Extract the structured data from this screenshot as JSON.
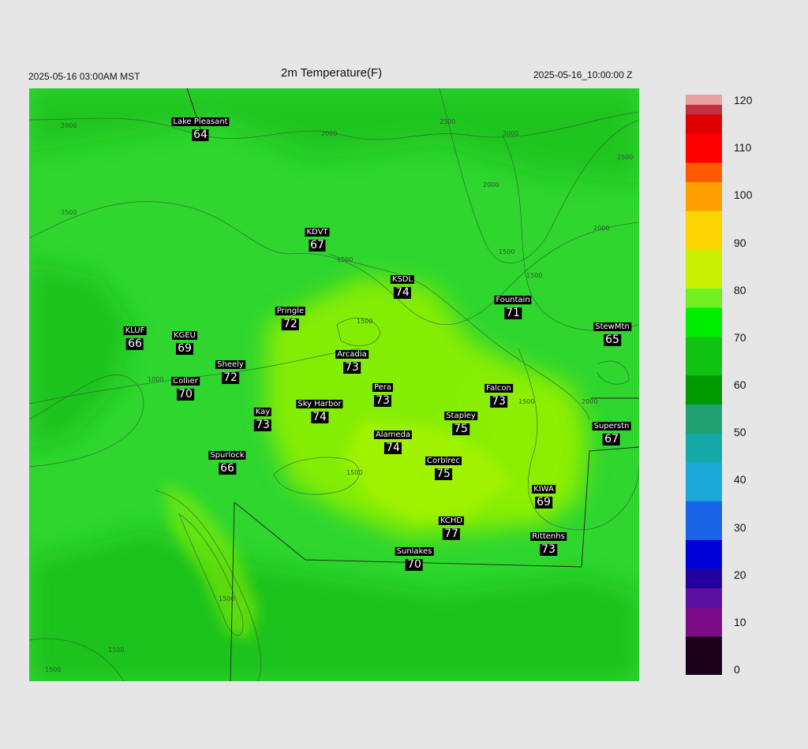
{
  "header": {
    "left": "2025-05-16 03:00AM MST",
    "title": "2m Temperature(F)",
    "right": "2025-05-16_10:00:00 Z"
  },
  "colorbar": {
    "ticks": [
      "120",
      "110",
      "100",
      "90",
      "80",
      "70",
      "60",
      "50",
      "40",
      "30",
      "20",
      "10",
      "0"
    ],
    "range": [
      0,
      120
    ],
    "stops": [
      {
        "v": 0,
        "c": "#1a0019"
      },
      {
        "v": 8,
        "c": "#7a0a86"
      },
      {
        "v": 13,
        "c": "#5b0fa0"
      },
      {
        "v": 18,
        "c": "#22009e"
      },
      {
        "v": 22,
        "c": "#0000d8"
      },
      {
        "v": 28,
        "c": "#1a64e8"
      },
      {
        "v": 35,
        "c": "#1aa8d8"
      },
      {
        "v": 43,
        "c": "#14a8a8"
      },
      {
        "v": 50,
        "c": "#20a070"
      },
      {
        "v": 55,
        "c": "#009a00"
      },
      {
        "v": 62,
        "c": "#11c311"
      },
      {
        "v": 70,
        "c": "#00ee00"
      },
      {
        "v": 76,
        "c": "#70f020"
      },
      {
        "v": 80,
        "c": "#c8f000"
      },
      {
        "v": 88,
        "c": "#ffd400"
      },
      {
        "v": 95,
        "c": "#ffa000"
      },
      {
        "v": 101,
        "c": "#ff5a00"
      },
      {
        "v": 106,
        "c": "#ff0000"
      },
      {
        "v": 112,
        "c": "#e00000"
      },
      {
        "v": 115,
        "c": "#c03040"
      },
      {
        "v": 118,
        "c": "#e8a0a0"
      },
      {
        "v": 120,
        "c": "#d0d0d0"
      }
    ]
  },
  "map_colors": {
    "base": "#2ed62e",
    "warm": "#8ef000",
    "warmest": "#a6f400",
    "cool": "#14b814"
  },
  "contour_labels": [
    "2000",
    "2000",
    "2500",
    "3000",
    "2500",
    "2000",
    "3500",
    "2000",
    "1500",
    "1500",
    "1500",
    "1000",
    "1500",
    "1500",
    "1500",
    "2000",
    "1500",
    "1500",
    "1500"
  ],
  "stations": [
    {
      "name": "Lake Pleasant",
      "value": "64"
    },
    {
      "name": "KDVT",
      "value": "67"
    },
    {
      "name": "KSDL",
      "value": "74"
    },
    {
      "name": "Fountain",
      "value": "71"
    },
    {
      "name": "Pringle",
      "value": "72"
    },
    {
      "name": "KLUF",
      "value": "66"
    },
    {
      "name": "KGEU",
      "value": "69"
    },
    {
      "name": "StewMtn",
      "value": "65"
    },
    {
      "name": "Arcadia",
      "value": "73"
    },
    {
      "name": "Sheely",
      "value": "72"
    },
    {
      "name": "Collier",
      "value": "70"
    },
    {
      "name": "Pera",
      "value": "73"
    },
    {
      "name": "Falcon",
      "value": "73"
    },
    {
      "name": "Sky Harbor",
      "value": "74"
    },
    {
      "name": "Kay",
      "value": "73"
    },
    {
      "name": "Stapley",
      "value": "75"
    },
    {
      "name": "Superstn",
      "value": "67"
    },
    {
      "name": "Alameda",
      "value": "74"
    },
    {
      "name": "Spurlock",
      "value": "66"
    },
    {
      "name": "Corblrec",
      "value": "75"
    },
    {
      "name": "KIWA",
      "value": "69"
    },
    {
      "name": "KCHD",
      "value": "77"
    },
    {
      "name": "Rittenhs",
      "value": "73"
    },
    {
      "name": "Sunlakes",
      "value": "70"
    }
  ]
}
